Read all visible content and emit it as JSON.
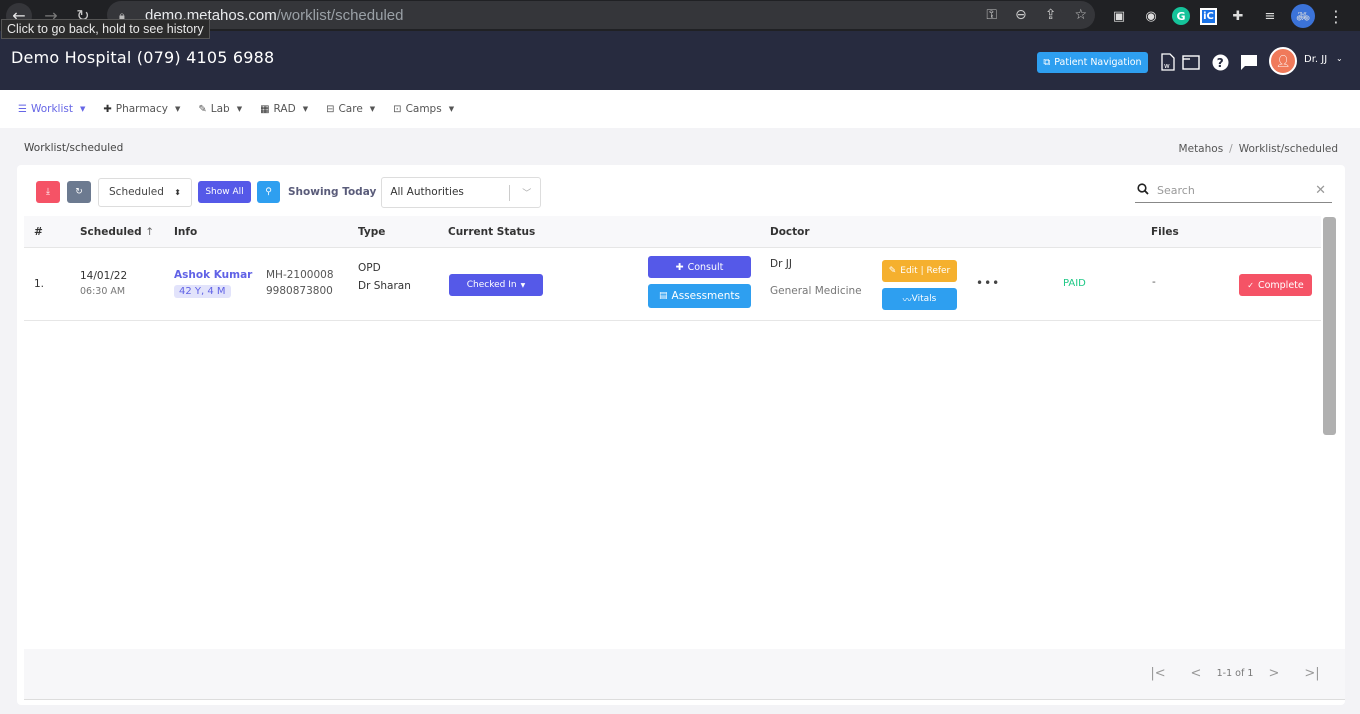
{
  "browser": {
    "url_domain": "demo.metahos.com",
    "url_path": "/worklist/scheduled",
    "tooltip": "Click to go back, hold to see history"
  },
  "header": {
    "title": "Demo Hospital (079) 4105 6988",
    "patient_nav_label": "Patient Navigation",
    "user_name": "Dr. JJ",
    "icons": [
      "word-doc-icon",
      "folder-icon",
      "help-icon",
      "chat-icon"
    ]
  },
  "menu": {
    "items": [
      {
        "label": "Worklist",
        "icon": "list-icon",
        "active": true
      },
      {
        "label": "Pharmacy",
        "icon": "plus-icon"
      },
      {
        "label": "Lab",
        "icon": "pencil-icon"
      },
      {
        "label": "RAD",
        "icon": "film-icon"
      },
      {
        "label": "Care",
        "icon": "bed-icon"
      },
      {
        "label": "Camps",
        "icon": "briefcase-icon"
      }
    ]
  },
  "page": {
    "title": "Worklist/scheduled",
    "breadcrumb": [
      "Metahos",
      "Worklist/scheduled"
    ]
  },
  "toolbar": {
    "status_value": "Scheduled",
    "show_all_label": "Show All",
    "showing_label": "Showing Today",
    "authority_value": "All Authorities",
    "search_placeholder": "Search"
  },
  "table": {
    "headers": {
      "num": "#",
      "scheduled": "Scheduled",
      "info": "Info",
      "type": "Type",
      "status": "Current Status",
      "doctor": "Doctor",
      "files": "Files"
    },
    "rows": [
      {
        "num": "1.",
        "date": "14/01/22",
        "time": "06:30 AM",
        "patient_name": "Ashok Kumar",
        "age": "42 Y, 4 M",
        "mrn": "MH-2100008",
        "phone": "9980873800",
        "type": "OPD",
        "type_doctor": "Dr Sharan",
        "status": "Checked In",
        "consult_label": "Consult",
        "assess_label": "Assessments",
        "doctor": "Dr JJ",
        "department": "General Medicine",
        "edit_label": "Edit | Refer",
        "vitals_label": "Vitals",
        "more": "•••",
        "payment": "PAID",
        "files": "-",
        "complete_label": "Complete"
      }
    ]
  },
  "pagination": {
    "text": "1-1 of 1"
  },
  "colors": {
    "header_bg": "#272b3f",
    "primary": "#5559e8",
    "info": "#2e9ff0",
    "danger": "#f55366",
    "warning": "#f5b02e",
    "success": "#1fc886"
  }
}
